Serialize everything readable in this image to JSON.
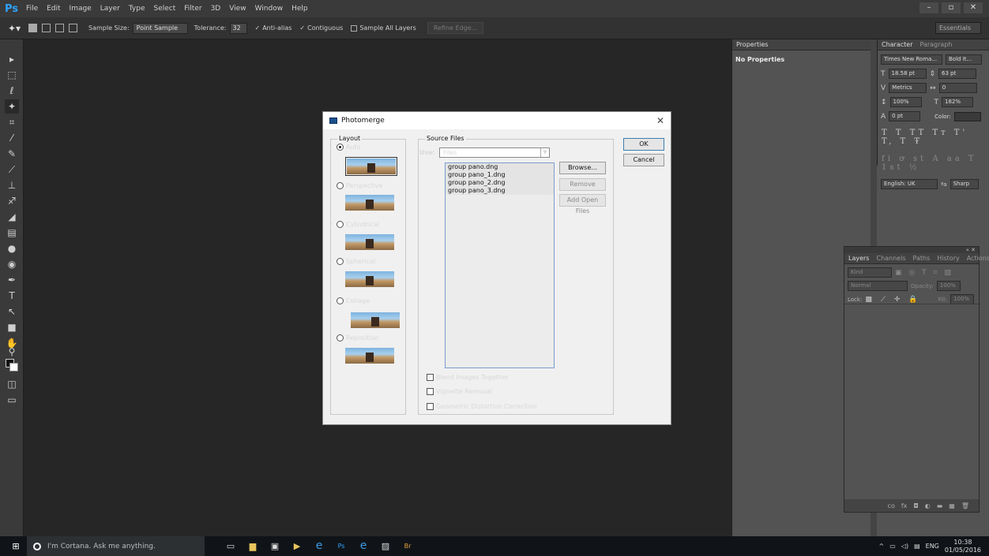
{
  "app": {
    "logo": "Ps",
    "menu": [
      "File",
      "Edit",
      "Image",
      "Layer",
      "Type",
      "Select",
      "Filter",
      "3D",
      "View",
      "Window",
      "Help"
    ],
    "window_controls": [
      "–",
      "▫",
      "✕"
    ]
  },
  "options_bar": {
    "sample_size_label": "Sample Size:",
    "sample_size_value": "Point Sample",
    "tolerance_label": "Tolerance:",
    "tolerance_value": "32",
    "anti_alias_label": "Anti-alias",
    "contiguous_label": "Contiguous",
    "sample_all_layers_label": "Sample All Layers",
    "refine_edge_label": "Refine Edge...",
    "workspace": "Essentials"
  },
  "properties_panel": {
    "tab": "Properties",
    "content": "No Properties"
  },
  "character_panel": {
    "tabs": [
      "Character",
      "Paragraph"
    ],
    "font_family": "Times New Roma...",
    "font_style": "Bold It...",
    "font_size": "18.58 pt",
    "leading": "63 pt",
    "kerning": "Metrics",
    "tracking": "0",
    "vertical_scale": "100%",
    "horizontal_scale": "182%",
    "baseline_shift": "0 pt",
    "color_label": "Color:",
    "language": "English: UK",
    "antialias": "Sharp",
    "aa_label": "ªa"
  },
  "layers_panel": {
    "tabs": [
      "Layers",
      "Channels",
      "Paths",
      "History",
      "Actions"
    ],
    "filter": "Kind",
    "blend_mode": "Normal",
    "opacity_label": "Opacity:",
    "opacity_value": "100%",
    "lock_label": "Lock:",
    "fill_label": "Fill:",
    "fill_value": "100%",
    "footer_icons": [
      "co",
      "fx",
      "◘",
      "◐",
      "▬",
      "▦",
      "🗑"
    ]
  },
  "dialog": {
    "title": "Photomerge",
    "layout_group": "Layout",
    "layouts": [
      {
        "label": "Auto",
        "selected": true
      },
      {
        "label": "Perspective",
        "selected": false
      },
      {
        "label": "Cylindrical",
        "selected": false
      },
      {
        "label": "Spherical",
        "selected": false
      },
      {
        "label": "Collage",
        "selected": false
      },
      {
        "label": "Reposition",
        "selected": false
      }
    ],
    "source_group": "Source Files",
    "use_label": "Use:",
    "use_value": "Files",
    "files": [
      "group pano.dng",
      "group pano_1.dng",
      "group pano_2.dng",
      "group pano_3.dng"
    ],
    "browse_label": "Browse...",
    "remove_label": "Remove",
    "add_open_label": "Add Open Files",
    "ok_label": "OK",
    "cancel_label": "Cancel",
    "options": [
      {
        "label": "Blend Images Together",
        "checked": true
      },
      {
        "label": "Vignette Removal",
        "checked": false
      },
      {
        "label": "Geometric Distortion Correction",
        "checked": false
      }
    ]
  },
  "taskbar": {
    "cortana_placeholder": "I'm Cortana. Ask me anything.",
    "apps": [
      "Ps",
      "Br"
    ],
    "lang": "ENG",
    "time": "10:38",
    "date": "01/05/2016"
  }
}
